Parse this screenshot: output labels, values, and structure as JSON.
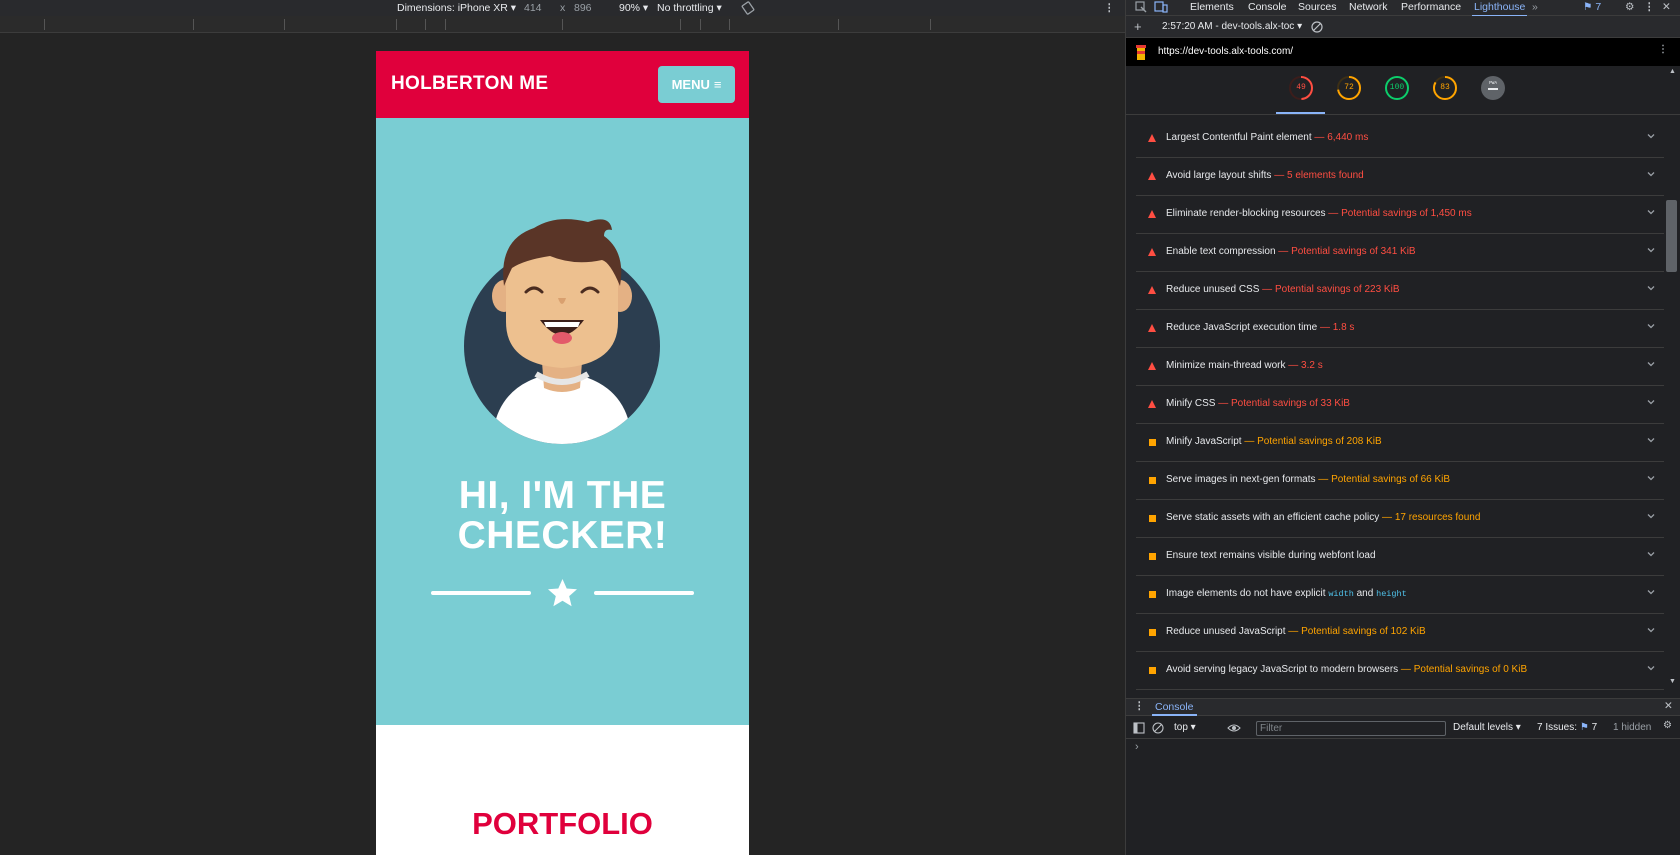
{
  "device_toolbar": {
    "dimensions_label": "Dimensions: iPhone XR ▾",
    "width": "414",
    "times": "x",
    "height": "896",
    "zoom": "90% ▾",
    "throttling": "No throttling ▾"
  },
  "page": {
    "brand": "HOLBERTON ME",
    "menu_label": "MENU",
    "hero_title_line1": "HI, I'M THE",
    "hero_title_line2": "CHECKER!",
    "section_title": "PORTFOLIO"
  },
  "devtools": {
    "tabs": [
      "Elements",
      "Console",
      "Sources",
      "Network",
      "Performance",
      "Lighthouse"
    ],
    "issues_count": "7",
    "lighthouse_report": "2:57:20 AM - dev-tools.alx-toc ▾",
    "url": "https://dev-tools.alx-tools.com/",
    "scores": [
      {
        "value": "49",
        "color": "#ff4e42"
      },
      {
        "value": "72",
        "color": "#ffa400"
      },
      {
        "value": "100",
        "color": "#0cce6b"
      },
      {
        "value": "83",
        "color": "#ffa400"
      },
      {
        "value": "PWA",
        "color": "#9aa0a6"
      }
    ],
    "audits": [
      {
        "title": "Largest Contentful Paint element",
        "detail": " — 6,440 ms",
        "severity": "fail"
      },
      {
        "title": "Avoid large layout shifts",
        "detail": " — 5 elements found",
        "severity": "fail"
      },
      {
        "title": "Eliminate render-blocking resources",
        "detail": " — Potential savings of 1,450 ms",
        "severity": "fail"
      },
      {
        "title": "Enable text compression",
        "detail": " — Potential savings of 341 KiB",
        "severity": "fail"
      },
      {
        "title": "Reduce unused CSS",
        "detail": " — Potential savings of 223 KiB",
        "severity": "fail"
      },
      {
        "title": "Reduce JavaScript execution time",
        "detail": " — 1.8 s",
        "severity": "fail"
      },
      {
        "title": "Minimize main-thread work",
        "detail": " — 3.2 s",
        "severity": "fail"
      },
      {
        "title": "Minify CSS",
        "detail": " — Potential savings of 33 KiB",
        "severity": "fail"
      },
      {
        "title": "Minify JavaScript",
        "detail": " — Potential savings of 208 KiB",
        "severity": "average"
      },
      {
        "title": "Serve images in next-gen formats",
        "detail": " — Potential savings of 66 KiB",
        "severity": "average"
      },
      {
        "title": "Serve static assets with an efficient cache policy",
        "detail": " — 17 resources found",
        "severity": "average"
      },
      {
        "title": "Ensure text remains visible during webfont load",
        "detail": "",
        "severity": "average"
      },
      {
        "title": "Image elements do not have explicit ",
        "code1": "width",
        "and": " and ",
        "code2": "height",
        "detail": "",
        "severity": "average"
      },
      {
        "title": "Reduce unused JavaScript",
        "detail": " — Potential savings of 102 KiB",
        "severity": "average"
      },
      {
        "title": "Avoid serving legacy JavaScript to modern browsers",
        "detail": " — Potential savings of 0 KiB",
        "severity": "average"
      }
    ],
    "drawer_tab": "Console",
    "console": {
      "context": "top ▾",
      "filter_placeholder": "Filter",
      "levels": "Default levels ▾",
      "issues_label": "7 Issues:",
      "issues_count": "7",
      "hidden": "1 hidden",
      "prompt": "›"
    }
  },
  "colors": {
    "brand_red": "#e0003c",
    "hero_teal": "#7acdd3",
    "fail": "#ff4e42",
    "average": "#ffa400",
    "pass": "#0cce6b",
    "accent": "#8ab4f8"
  }
}
